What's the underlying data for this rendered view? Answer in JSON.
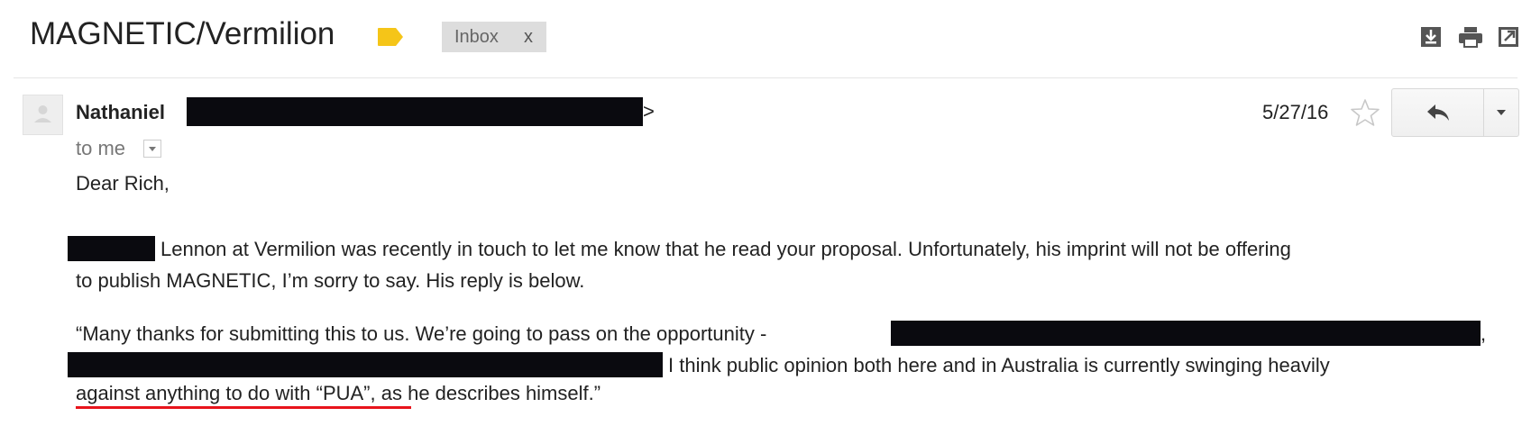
{
  "subject": "MAGNETIC/Vermilion",
  "label": {
    "name": "Inbox",
    "remove": "x",
    "tag_color": "#f5c518"
  },
  "toolbar": {
    "icons": [
      "download-icon",
      "print-icon",
      "new-window-icon"
    ]
  },
  "message": {
    "sender_name": "Nathaniel",
    "sender_close": ">",
    "recipient": "to me",
    "date": "5/27/16",
    "reply_icon": "reply-icon",
    "more_icon": "chevron-down-icon",
    "star_icon": "star-outline-icon"
  },
  "body": {
    "greeting": "Dear Rich,",
    "para1_line1": "Lennon at Vermilion was recently in touch to let me know that he read your proposal. Unfortunately, his imprint will not be offering",
    "para1_line2": "to publish MAGNETIC, I’m sorry to say. His reply is below.",
    "para2_line1": "“Many thanks for submitting this to us. We’re going to pass on the opportunity  -",
    "para2_line1_end": ",",
    "para2_line2": "I think public opinion both here and in Australia is currently swinging heavily",
    "para2_line3_underlined": "against anything to do with “PUA”",
    "para2_line3_rest": ", as he describes himself.”"
  },
  "colors": {
    "redaction": "#0a0a0f",
    "underline_highlight": "#e8141c",
    "chip_background": "#dddddd"
  }
}
